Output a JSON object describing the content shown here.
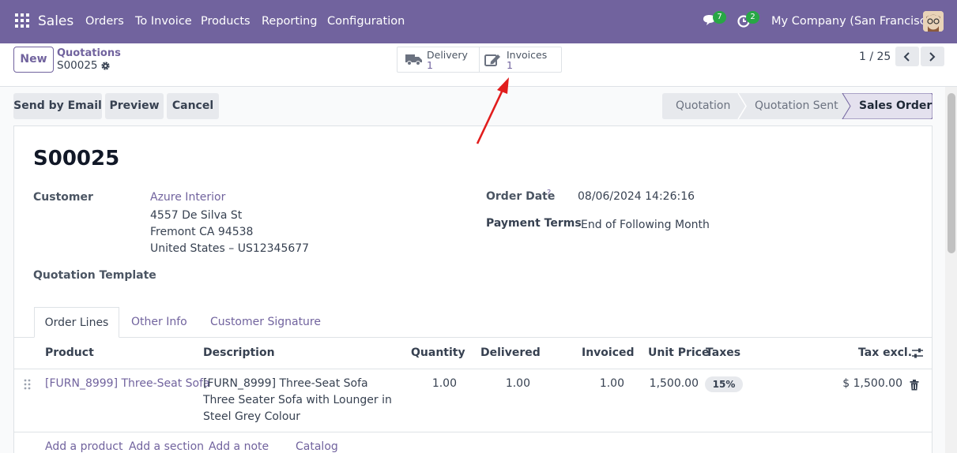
{
  "navbar": {
    "app_name": "Sales",
    "menu": [
      "Orders",
      "To Invoice",
      "Products",
      "Reporting",
      "Configuration"
    ],
    "chat_count": "7",
    "activity_count": "2",
    "company": "My Company (San Francisco)",
    "accent": "#71639e"
  },
  "control_panel": {
    "new_label": "New",
    "breadcrumb_parent": "Quotations",
    "breadcrumb_current": "S00025",
    "smart_buttons": [
      {
        "label": "Delivery",
        "value": "1",
        "icon": "truck-icon"
      },
      {
        "label": "Invoices",
        "value": "1",
        "icon": "edit-invoice-icon"
      }
    ],
    "pager": "1 / 25"
  },
  "actions": [
    "Send by Email",
    "Preview",
    "Cancel"
  ],
  "statusbar": {
    "stages": [
      "Quotation",
      "Quotation Sent",
      "Sales Order"
    ],
    "active": "Sales Order"
  },
  "form": {
    "name": "S00025",
    "customer_label": "Customer",
    "customer_name": "Azure Interior",
    "customer_address": [
      "4557 De Silva St",
      "Fremont CA 94538",
      "United States – US12345677"
    ],
    "quotation_template_label": "Quotation Template",
    "order_date_label": "Order Date",
    "order_date_help": "?",
    "order_date": "08/06/2024 14:26:16",
    "payment_terms_label": "Payment Terms",
    "payment_terms": "End of Following Month"
  },
  "tabs": [
    "Order Lines",
    "Other Info",
    "Customer Signature"
  ],
  "order_lines": {
    "columns": [
      "Product",
      "Description",
      "Quantity",
      "Delivered",
      "Invoiced",
      "Unit Price",
      "Taxes",
      "Tax excl."
    ],
    "rows": [
      {
        "product": "[FURN_8999] Three-Seat Sofa",
        "description": [
          "[FURN_8999] Three-Seat Sofa",
          "Three Seater Sofa with Lounger in",
          "Steel Grey Colour"
        ],
        "quantity": "1.00",
        "delivered": "1.00",
        "invoiced": "1.00",
        "unit_price": "1,500.00",
        "taxes": "15%",
        "subtotal": "$ 1,500.00"
      }
    ],
    "footer_links": [
      "Add a product",
      "Add a section",
      "Add a note",
      "Catalog"
    ]
  }
}
